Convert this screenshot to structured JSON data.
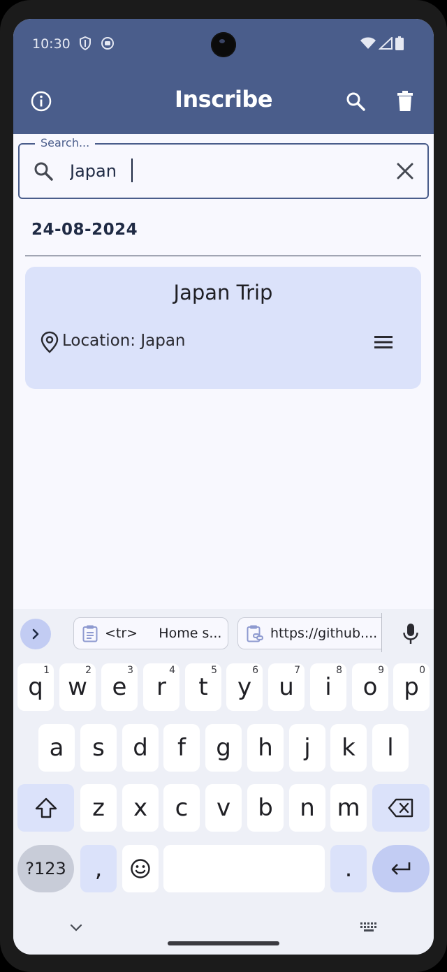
{
  "status_bar": {
    "time": "10:30"
  },
  "app_bar": {
    "title": "Inscribe"
  },
  "search": {
    "label": "Search...",
    "value": "Japan"
  },
  "notes": {
    "date": "24-08-2024",
    "items": [
      {
        "title": "Japan Trip",
        "location": "Location: Japan"
      }
    ]
  },
  "keyboard": {
    "suggestions": [
      "<tr>     Home s...",
      "https://github...."
    ],
    "row1": [
      {
        "key": "q",
        "hint": "1"
      },
      {
        "key": "w",
        "hint": "2"
      },
      {
        "key": "e",
        "hint": "3"
      },
      {
        "key": "r",
        "hint": "4"
      },
      {
        "key": "t",
        "hint": "5"
      },
      {
        "key": "y",
        "hint": "6"
      },
      {
        "key": "u",
        "hint": "7"
      },
      {
        "key": "i",
        "hint": "8"
      },
      {
        "key": "o",
        "hint": "9"
      },
      {
        "key": "p",
        "hint": "0"
      }
    ],
    "row2": [
      "a",
      "s",
      "d",
      "f",
      "g",
      "h",
      "j",
      "k",
      "l"
    ],
    "row3": [
      "z",
      "x",
      "c",
      "v",
      "b",
      "n",
      "m"
    ],
    "symbols_label": "?123",
    "comma": ",",
    "period": "."
  },
  "colors": {
    "primary": "#4a5d8b",
    "card": "#dbe2fa",
    "background": "#f8f8fe",
    "accent": "#c2ccf3"
  }
}
